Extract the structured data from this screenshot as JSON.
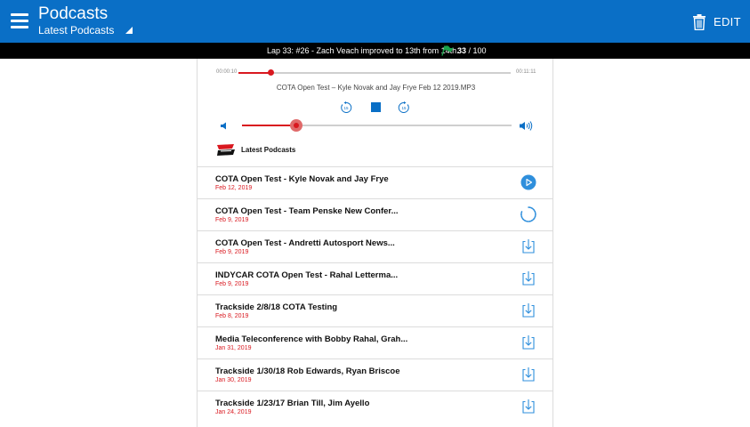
{
  "header": {
    "title": "Podcasts",
    "subtitle": "Latest Podcasts",
    "edit_label": "EDIT",
    "color": "#0a6fc6"
  },
  "ticker": {
    "message": "Lap 33: #26 - Zach Veach improved to 13th from 14th.",
    "lap_current": "33",
    "lap_total": " / 100",
    "flag_color": "#19a34a"
  },
  "player": {
    "time_elapsed": "00:00:10",
    "time_total": "00:11:11",
    "progress": 0.12,
    "track_title": "COTA Open Test – Kyle Novak and Jay Frye Feb 12 2019.MP3",
    "volume": 0.2,
    "controls": [
      "rewind-15-icon",
      "stop-icon",
      "forward-15-icon"
    ]
  },
  "section": {
    "label": "Latest Podcasts",
    "logo": "indycar-logo"
  },
  "podcasts": [
    {
      "title": "COTA Open Test - Kyle Novak and Jay Frye",
      "date": "Feb 12, 2019",
      "action": "play"
    },
    {
      "title": "COTA Open Test - Team Penske New Confer...",
      "date": "Feb 9, 2019",
      "action": "loading"
    },
    {
      "title": "COTA Open Test - Andretti Autosport News...",
      "date": "Feb 9, 2019",
      "action": "download"
    },
    {
      "title": "INDYCAR COTA Open Test - Rahal Letterma...",
      "date": "Feb 9, 2019",
      "action": "download"
    },
    {
      "title": "Trackside 2/8/18 COTA Testing",
      "date": "Feb 8, 2019",
      "action": "download"
    },
    {
      "title": "Media Teleconference with Bobby Rahal, Grah...",
      "date": "Jan 31, 2019",
      "action": "download"
    },
    {
      "title": "Trackside 1/30/18 Rob Edwards, Ryan Briscoe",
      "date": "Jan 30, 2019",
      "action": "download"
    },
    {
      "title": "Trackside 1/23/17 Brian Till, Jim Ayello",
      "date": "Jan 24, 2019",
      "action": "download"
    }
  ]
}
